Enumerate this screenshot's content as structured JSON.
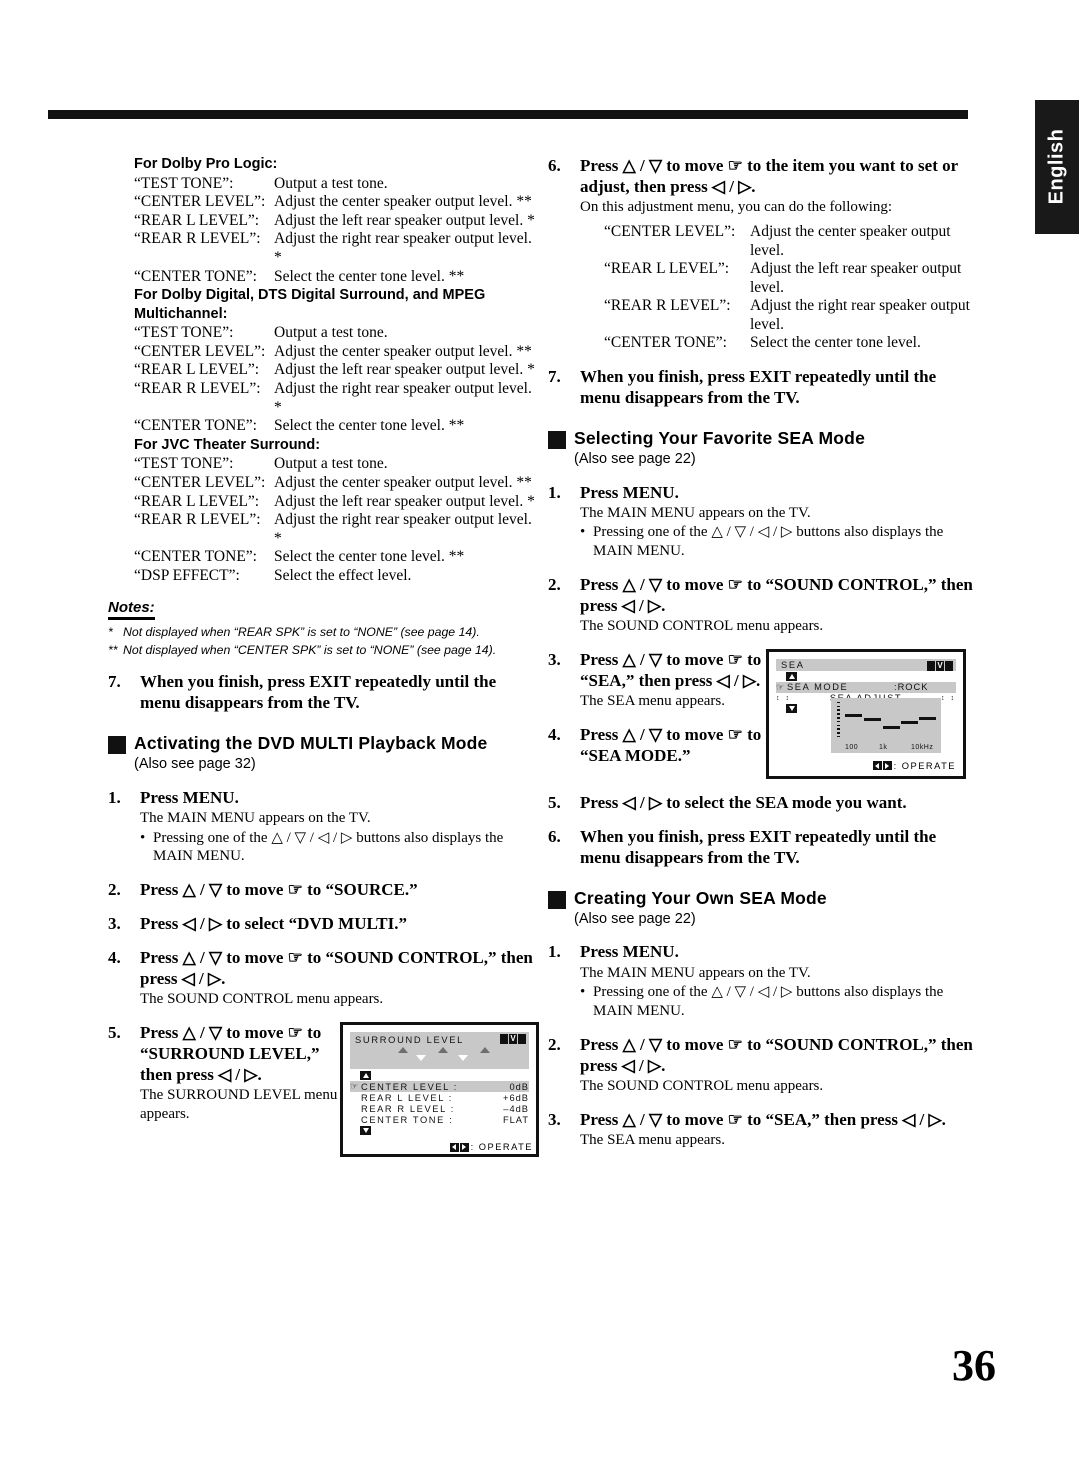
{
  "language_tab": "English",
  "page_number": "36",
  "left_column": {
    "groups": [
      {
        "heading": "For Dolby Pro Logic:",
        "rows": [
          {
            "term": "“TEST TONE”:",
            "desc": "Output a test tone."
          },
          {
            "term": "“CENTER LEVEL”:",
            "desc": "Adjust the center speaker output level. **"
          },
          {
            "term": "“REAR L LEVEL”:",
            "desc": "Adjust the left rear speaker output level. *"
          },
          {
            "term": "“REAR R LEVEL”:",
            "desc": "Adjust the right rear speaker output level. *"
          },
          {
            "term": "“CENTER TONE”:",
            "desc": "Select the center tone level. **"
          }
        ]
      },
      {
        "heading": "For Dolby Digital, DTS Digital Surround, and MPEG Multichannel:",
        "rows": [
          {
            "term": "“TEST TONE”:",
            "desc": "Output a test tone."
          },
          {
            "term": "“CENTER LEVEL”:",
            "desc": "Adjust the center speaker output level. **"
          },
          {
            "term": "“REAR L LEVEL”:",
            "desc": "Adjust the left rear speaker output level. *"
          },
          {
            "term": "“REAR R LEVEL”:",
            "desc": "Adjust the right rear speaker output level. *"
          },
          {
            "term": "“CENTER TONE”:",
            "desc": "Select the center tone level. **"
          }
        ]
      },
      {
        "heading": "For JVC Theater Surround:",
        "rows": [
          {
            "term": "“TEST TONE”:",
            "desc": "Output a test tone."
          },
          {
            "term": "“CENTER LEVEL”:",
            "desc": "Adjust the center speaker output level. **"
          },
          {
            "term": "“REAR L LEVEL”:",
            "desc": "Adjust the left rear speaker output level. *"
          },
          {
            "term": "“REAR R LEVEL”:",
            "desc": "Adjust the right rear speaker output level. *"
          },
          {
            "term": "“CENTER TONE”:",
            "desc": "Select the center tone level. **"
          },
          {
            "term": "“DSP EFFECT”:",
            "desc": "Select the effect level."
          }
        ]
      }
    ],
    "notes": {
      "heading": "Notes:",
      "items": [
        {
          "mark": "*",
          "text": "Not displayed when “REAR SPK” is set to “NONE” (see page 14)."
        },
        {
          "mark": "**",
          "text": "Not displayed  when “CENTER SPK” is set to “NONE” (see page 14)."
        }
      ]
    },
    "step7": {
      "num": "7.",
      "title": "When you finish, press EXIT repeatedly until the menu disappears from the TV."
    },
    "section": {
      "title": "Activating the DVD MULTI Playback Mode",
      "subtitle": "(Also see page 32)"
    },
    "steps": [
      {
        "num": "1.",
        "title": "Press MENU.",
        "sub": "The MAIN MENU appears on the TV.",
        "bullet": "Pressing one of the △ / ▽ / ◁ / ▷ buttons also displays the MAIN MENU."
      },
      {
        "num": "2.",
        "title": "Press △ / ▽ to move ☞ to “SOURCE.”"
      },
      {
        "num": "3.",
        "title": "Press ◁ / ▷ to select “DVD MULTI.”"
      },
      {
        "num": "4.",
        "title": "Press △ / ▽ to move ☞ to “SOUND CONTROL,” then press ◁ / ▷.",
        "sub": "The SOUND CONTROL menu appears."
      },
      {
        "num": "5.",
        "title": "Press △ / ▽ to move ☞ to “SURROUND LEVEL,” then press ◁ / ▷.",
        "sub": "The SURROUND LEVEL menu appears."
      }
    ]
  },
  "right_column": {
    "step6": {
      "num": "6.",
      "title": "Press △ / ▽ to move ☞ to the item you want to set or adjust, then press ◁ / ▷.",
      "sub": "On this adjustment menu, you can do the following:",
      "rows": [
        {
          "term": "“CENTER LEVEL”:",
          "desc": "Adjust the center speaker output level."
        },
        {
          "term": "“REAR L LEVEL”:",
          "desc": "Adjust the left rear speaker output level."
        },
        {
          "term": "“REAR R LEVEL”:",
          "desc": "Adjust the right rear speaker output level."
        },
        {
          "term": "“CENTER TONE”:",
          "desc": "Select the center tone level."
        }
      ]
    },
    "step7": {
      "num": "7.",
      "title": "When you finish, press EXIT repeatedly until the menu disappears from the TV."
    },
    "section_favorite": {
      "title": "Selecting Your Favorite SEA Mode",
      "subtitle": "(Also see page 22)"
    },
    "favorite_steps": [
      {
        "num": "1.",
        "title": "Press MENU.",
        "sub": "The MAIN MENU appears on the TV.",
        "bullet": "Pressing one of the △ / ▽ / ◁ / ▷ buttons also displays the MAIN MENU."
      },
      {
        "num": "2.",
        "title": "Press △ / ▽ to move ☞ to “SOUND CONTROL,” then press ◁ / ▷.",
        "sub": "The SOUND CONTROL menu appears."
      },
      {
        "num": "3.",
        "title": "Press △ / ▽ to move ☞ to “SEA,” then press ◁ / ▷.",
        "sub": "The SEA menu appears."
      },
      {
        "num": "4.",
        "title": "Press △ / ▽ to move ☞ to “SEA MODE.”"
      },
      {
        "num": "5.",
        "title": "Press ◁ / ▷ to select the SEA mode you want."
      },
      {
        "num": "6.",
        "title": "When you finish, press EXIT repeatedly until the menu disappears from the TV."
      }
    ],
    "section_creating": {
      "title": "Creating Your Own SEA Mode",
      "subtitle": "(Also see page 22)"
    },
    "creating_steps": [
      {
        "num": "1.",
        "title": "Press MENU.",
        "sub": "The MAIN MENU appears on the TV.",
        "bullet": "Pressing one of the △ / ▽ / ◁ / ▷ buttons also displays the MAIN MENU."
      },
      {
        "num": "2.",
        "title": "Press △ / ▽ to move ☞ to “SOUND CONTROL,” then press ◁ / ▷.",
        "sub": "The SOUND CONTROL menu appears."
      },
      {
        "num": "3.",
        "title": "Press △ / ▽ to move ☞ to “SEA,” then press ◁ / ▷.",
        "sub": "The SEA menu appears."
      }
    ]
  },
  "figure_surround": {
    "title": "SURROUND  LEVEL",
    "brand": "JVC",
    "rows": [
      {
        "label": "CENTER  LEVEL :",
        "value": "0dB",
        "selected": true
      },
      {
        "label": "REAR  L  LEVEL :",
        "value": "+6dB",
        "selected": false
      },
      {
        "label": "REAR  R  LEVEL :",
        "value": "–4dB",
        "selected": false
      },
      {
        "label": "CENTER  TONE   :",
        "value": "FLAT",
        "selected": false
      }
    ],
    "footer": ": OPERATE"
  },
  "figure_sea": {
    "title": "SEA",
    "brand": "JVC",
    "mode_label": "SEA  MODE",
    "mode_value": ":ROCK",
    "adjust_label": "SEA  ADJUST",
    "adjust_marks_left": "↕ ↕",
    "adjust_marks_right": "↕ ↕",
    "axis_labels": [
      "100",
      "1k",
      "10kHz"
    ],
    "footer": ": OPERATE"
  }
}
